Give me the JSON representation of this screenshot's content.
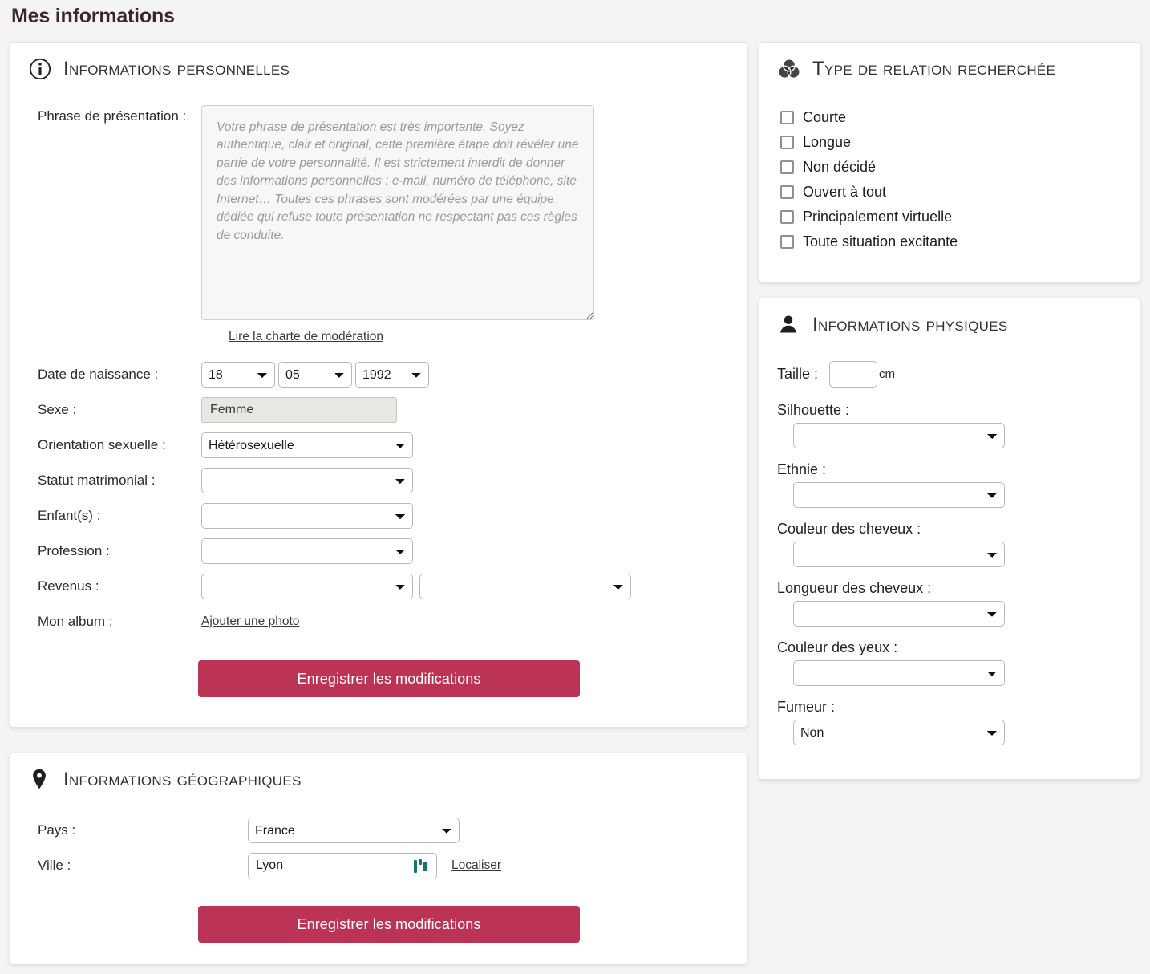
{
  "page": {
    "title": "Mes informations",
    "accent_color": "#bc3455",
    "title_color": "#3b2435",
    "background_color": "#f4f4f4",
    "loader_color": "#14737a"
  },
  "personal": {
    "header": {
      "title": "Informations personnelles",
      "icon": "info-circle-icon"
    },
    "presentation": {
      "label": "Phrase de présentation :",
      "value": "",
      "placeholder": "Votre phrase de présentation est très importante. Soyez authentique, clair et original, cette première étape doit révéler une partie de votre personnalité. Il est strictement interdit de donner des informations personnelles : e-mail, numéro de téléphone, site Internet… Toutes ces phrases sont modérées par une équipe dédiée qui refuse toute présentation ne respectant pas ces règles de conduite."
    },
    "charte_link": "Lire la charte de modération",
    "birthdate": {
      "label": "Date de naissance :",
      "day": "18",
      "month": "05",
      "year": "1992"
    },
    "sexe": {
      "label": "Sexe :",
      "value": "Femme"
    },
    "orientation": {
      "label": "Orientation sexuelle :",
      "value": "Hétérosexuelle"
    },
    "statut": {
      "label": "Statut matrimonial :",
      "value": ""
    },
    "enfants": {
      "label": "Enfant(s) :",
      "value": ""
    },
    "profession": {
      "label": "Profession :",
      "value": ""
    },
    "revenus": {
      "label": "Revenus :",
      "value1": "",
      "value2": ""
    },
    "album": {
      "label": "Mon album :",
      "link": "Ajouter une photo"
    },
    "save_label": "Enregistrer les modifications"
  },
  "relation": {
    "header": {
      "title": "Type de relation recherchée",
      "icon": "venn-circles-icon"
    },
    "options": [
      {
        "label": "Courte",
        "checked": false
      },
      {
        "label": "Longue",
        "checked": false
      },
      {
        "label": "Non décidé",
        "checked": false
      },
      {
        "label": "Ouvert à tout",
        "checked": false
      },
      {
        "label": "Principalement virtuelle",
        "checked": false
      },
      {
        "label": "Toute situation excitante",
        "checked": false
      }
    ]
  },
  "physique": {
    "header": {
      "title": "Informations physiques",
      "icon": "person-icon"
    },
    "taille": {
      "label": "Taille :",
      "value": "",
      "unit": "cm"
    },
    "silhouette": {
      "label": "Silhouette :",
      "value": ""
    },
    "ethnie": {
      "label": "Ethnie :",
      "value": ""
    },
    "couleur_cheveux": {
      "label": "Couleur des cheveux :",
      "value": ""
    },
    "longueur_cheveux": {
      "label": "Longueur des cheveux :",
      "value": ""
    },
    "couleur_yeux": {
      "label": "Couleur des yeux :",
      "value": ""
    },
    "fumeur": {
      "label": "Fumeur :",
      "value": "Non"
    }
  },
  "geo": {
    "header": {
      "title": "Informations géographiques",
      "icon": "map-pin-icon"
    },
    "pays": {
      "label": "Pays :",
      "value": "France"
    },
    "ville": {
      "label": "Ville :",
      "value": "Lyon",
      "loader": "loading-bars-icon"
    },
    "localiser_link": "Localiser",
    "save_label": "Enregistrer les modifications"
  }
}
